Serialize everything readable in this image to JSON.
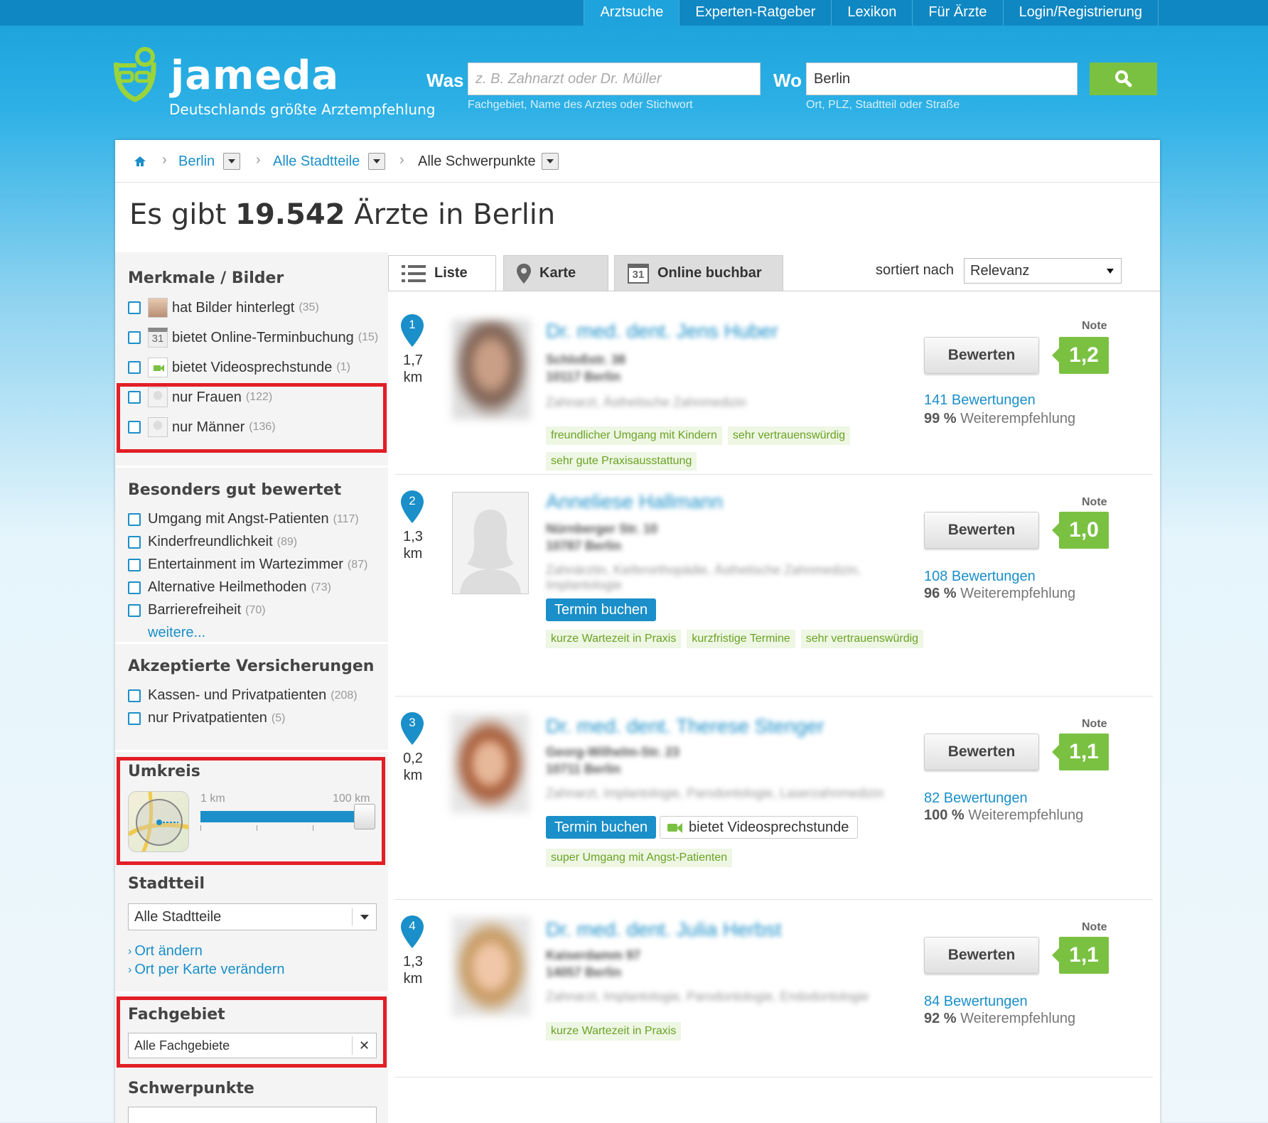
{
  "topnav": [
    "Arztsuche",
    "Experten-Ratgeber",
    "Lexikon",
    "Für Ärzte",
    "Login/Registrierung"
  ],
  "header": {
    "logo": "jameda",
    "tagline": "Deutschlands größte Arztempfehlung",
    "was_label": "Was",
    "was_placeholder": "z. B. Zahnarzt oder Dr. Müller",
    "was_hint": "Fachgebiet, Name des Arztes oder Stichwort",
    "wo_label": "Wo",
    "wo_value": "Berlin",
    "wo_hint": "Ort, PLZ, Stadtteil oder Straße"
  },
  "breadcrumb": {
    "city": "Berlin",
    "district": "Alle Stadtteile",
    "focus": "Alle Schwerpunkte"
  },
  "title": {
    "pre": "Es gibt ",
    "count": "19.542",
    "post": " Ärzte in Berlin"
  },
  "sidebar": {
    "merkmale": {
      "heading": "Merkmale / Bilder",
      "items": [
        {
          "label": "hat Bilder hinterlegt",
          "count": "(35)"
        },
        {
          "label": "bietet Online-Terminbuchung",
          "count": "(15)"
        },
        {
          "label": "bietet Videosprechstunde",
          "count": "(1)"
        },
        {
          "label": "nur Frauen",
          "count": "(122)"
        },
        {
          "label": "nur Männer",
          "count": "(136)"
        }
      ]
    },
    "besonders": {
      "heading": "Besonders gut bewertet",
      "items": [
        {
          "label": "Umgang mit Angst-Patienten",
          "count": "(117)"
        },
        {
          "label": "Kinderfreundlichkeit",
          "count": "(89)"
        },
        {
          "label": "Entertainment im Wartezimmer",
          "count": "(87)"
        },
        {
          "label": "Alternative Heilmethoden",
          "count": "(73)"
        },
        {
          "label": "Barrierefreiheit",
          "count": "(70)"
        }
      ],
      "more": "weitere..."
    },
    "versicherungen": {
      "heading": "Akzeptierte Versicherungen",
      "items": [
        {
          "label": "Kassen- und Privatpatienten",
          "count": "(208)"
        },
        {
          "label": "nur Privatpatienten",
          "count": "(5)"
        }
      ]
    },
    "umkreis": {
      "heading": "Umkreis",
      "min": "1 km",
      "max": "100 km",
      "level": 1.0
    },
    "stadtteil": {
      "heading": "Stadtteil",
      "value": "Alle Stadtteile",
      "link1": "Ort ändern",
      "link2": "Ort per Karte verändern"
    },
    "fachgebiet": {
      "heading": "Fachgebiet",
      "value": "Alle Fachgebiete"
    },
    "schwerpunkte": {
      "heading": "Schwerpunkte"
    }
  },
  "tabs": {
    "liste": "Liste",
    "karte": "Karte",
    "online": "Online buchbar",
    "cal_num": "31"
  },
  "sort": {
    "label": "sortiert nach",
    "value": "Relevanz"
  },
  "results": [
    {
      "num": "1",
      "dist": "1,7",
      "unit": "km",
      "name": "Dr. med. dent. Jens Huber",
      "street": "Schloßstr. 38",
      "city": "10117 Berlin",
      "spec": "Zahnarzt, Ästhetische Zahnmedizin",
      "tags": [
        "freundlicher Umgang mit Kindern",
        "sehr vertrauenswürdig",
        "sehr gute Praxisausstattung"
      ],
      "note_label": "Note",
      "rate": "Bewerten",
      "grade": "1,2",
      "reviews": "141 Bewertungen",
      "rec_pct": "99 %",
      "rec_text": "Weiterempfehlung"
    },
    {
      "num": "2",
      "dist": "1,3",
      "unit": "km",
      "name": "Anneliese Hallmann",
      "street": "Nürnberger Str. 10",
      "city": "10787 Berlin",
      "spec": "Zahnärztin, Kieferorthopädie, Ästhetische Zahnmedizin, Implantologie",
      "termin": "Termin buchen",
      "tags": [
        "kurze Wartezeit in Praxis",
        "kurzfristige Termine",
        "sehr vertrauenswürdig"
      ],
      "note_label": "Note",
      "rate": "Bewerten",
      "grade": "1,0",
      "reviews": "108 Bewertungen",
      "rec_pct": "96 %",
      "rec_text": "Weiterempfehlung"
    },
    {
      "num": "3",
      "dist": "0,2",
      "unit": "km",
      "name": "Dr. med. dent. Therese Stenger",
      "street": "Georg-Wilhelm-Str. 23",
      "city": "10711 Berlin",
      "spec": "Zahnarzt, Implantologie, Parodontologie, Laserzahnmedizin",
      "termin": "Termin buchen",
      "video": "bietet Videosprechstunde",
      "tags": [
        "super Umgang mit Angst-Patienten"
      ],
      "note_label": "Note",
      "rate": "Bewerten",
      "grade": "1,1",
      "reviews": "82 Bewertungen",
      "rec_pct": "100 %",
      "rec_text": "Weiterempfehlung"
    },
    {
      "num": "4",
      "dist": "1,3",
      "unit": "km",
      "name": "Dr. med. dent. Julia Herbst",
      "street": "Kaiserdamm 97",
      "city": "14057 Berlin",
      "spec": "Zahnarzt, Implantologie, Parodontologie, Endodontologie",
      "tags": [
        "kurze Wartezeit in Praxis"
      ],
      "note_label": "Note",
      "rate": "Bewerten",
      "grade": "1,1",
      "reviews": "84 Bewertungen",
      "rec_pct": "92 %",
      "rec_text": "Weiterempfehlung"
    }
  ],
  "colors": {
    "brand_blue": "#1a8fc9",
    "green": "#7ac142",
    "highlight_red": "#e21e26"
  }
}
